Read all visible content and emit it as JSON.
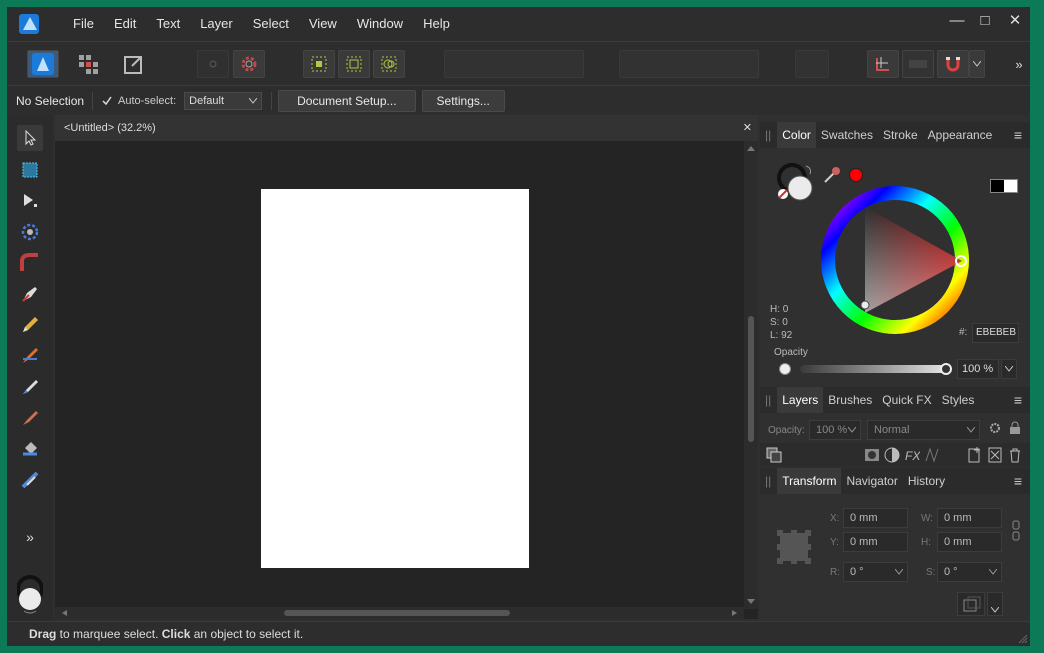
{
  "menu": {
    "items": [
      "File",
      "Edit",
      "Text",
      "Layer",
      "Select",
      "View",
      "Window",
      "Help"
    ]
  },
  "window": {
    "minimize": "—",
    "maximize": "□",
    "close": "✕"
  },
  "context": {
    "selection": "No Selection",
    "auto_select_label": "Auto-select:",
    "auto_select_value": "Default",
    "document_setup": "Document Setup...",
    "settings": "Settings..."
  },
  "document": {
    "tab_title": "<Untitled> (32.2%)",
    "close": "✕"
  },
  "color_panel": {
    "tabs": [
      "Color",
      "Swatches",
      "Stroke",
      "Appearance"
    ],
    "h": "H: 0",
    "s": "S: 0",
    "l": "L: 92",
    "hex_label": "#:",
    "hex_value": "EBEBEB",
    "opacity_label": "Opacity",
    "opacity_value": "100 %"
  },
  "layers_panel": {
    "tabs": [
      "Layers",
      "Brushes",
      "Quick FX",
      "Styles"
    ],
    "opacity_label": "Opacity:",
    "opacity_value": "100 %",
    "blend_mode": "Normal"
  },
  "transform_panel": {
    "tabs": [
      "Transform",
      "Navigator",
      "History"
    ],
    "x_label": "X:",
    "x_value": "0 mm",
    "y_label": "Y:",
    "y_value": "0 mm",
    "w_label": "W:",
    "w_value": "0 mm",
    "h_label": "H:",
    "h_value": "0 mm",
    "r_label": "R:",
    "r_value": "0 °",
    "s_label": "S:",
    "s_value": "0 °"
  },
  "status": {
    "drag": "Drag",
    "drag_text": " to marquee select. ",
    "click": "Click",
    "click_text": " an object to select it."
  },
  "colors": {
    "accent": "#1c7bd9",
    "primary_swatch": "#ebebeb",
    "hue_handle": "#ff0000"
  }
}
